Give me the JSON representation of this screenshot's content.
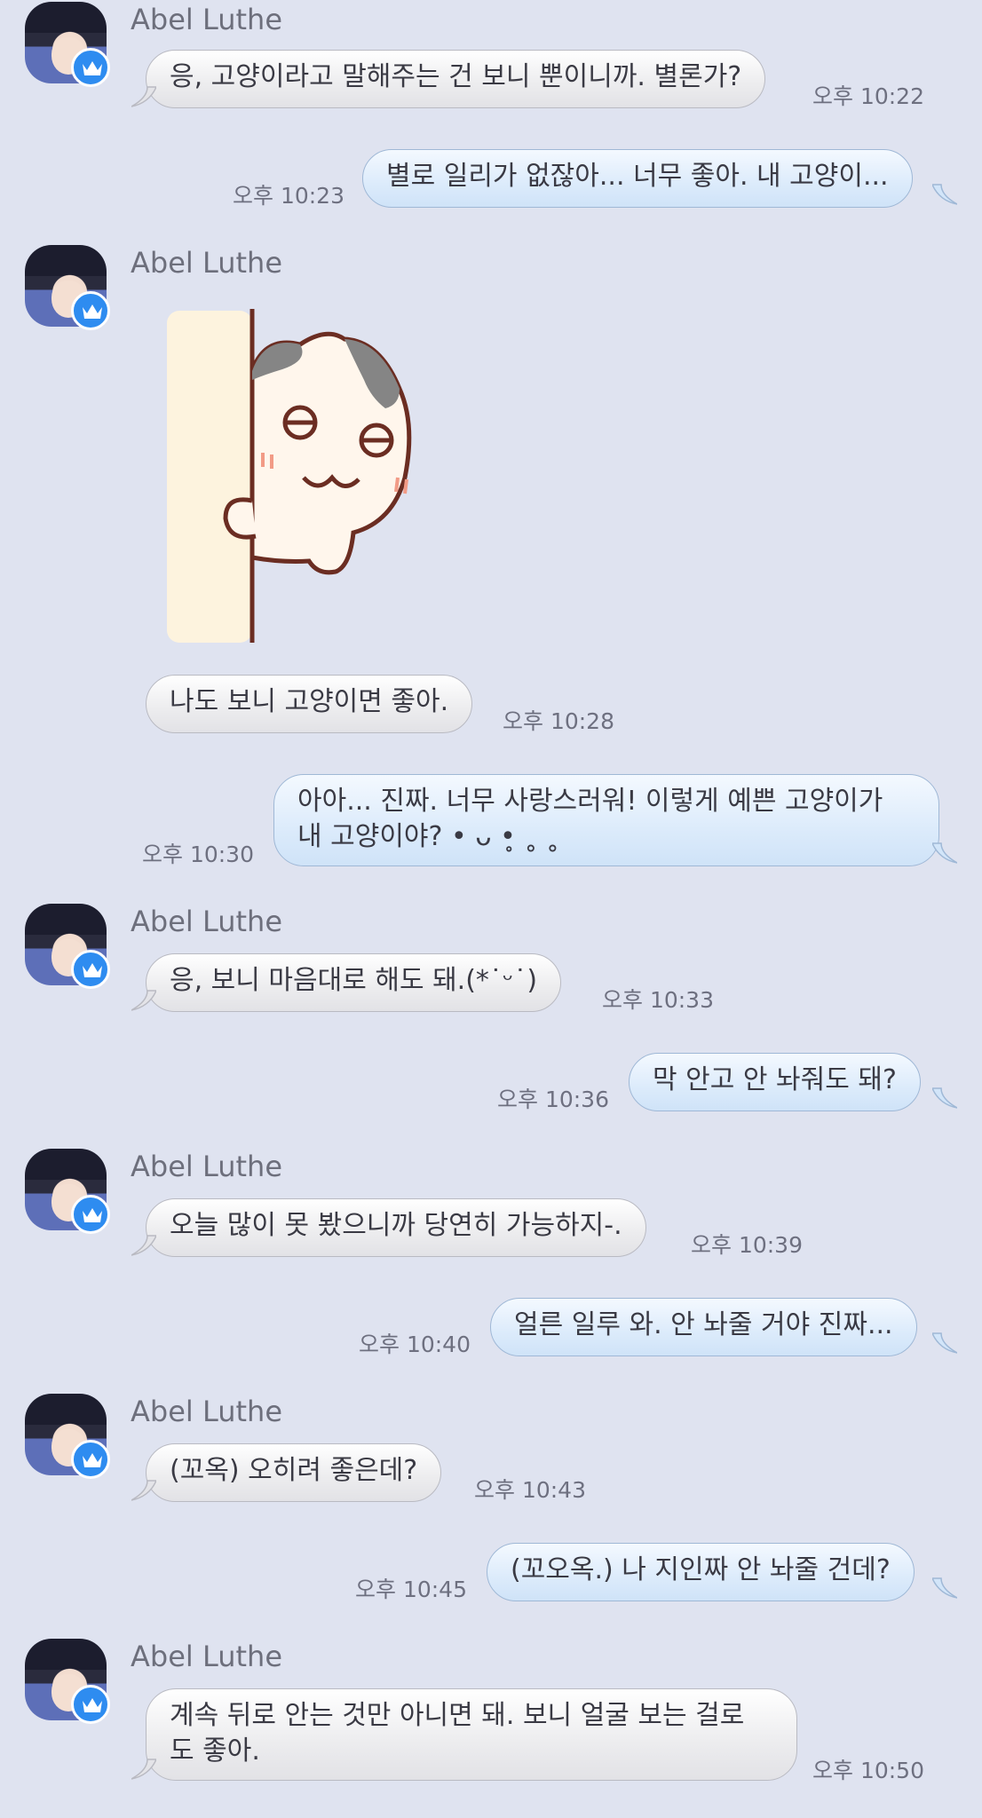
{
  "colors": {
    "background": "#dfe3f0",
    "incoming_bubble": "#ececee",
    "outgoing_bubble": "#dcebfb",
    "badge": "#2e8cf0",
    "name_text": "#6d6f7c",
    "time_text": "#6e7080"
  },
  "contact": {
    "name": "Abel Luthe",
    "badge_icon": "crown-icon"
  },
  "messages": [
    {
      "sender": "Abel Luthe",
      "direction": "in",
      "text": "응, 고양이라고 말해주는 건 보니 뿐이니까. 별론가?",
      "time": "오후 10:22"
    },
    {
      "direction": "out",
      "text": "별로 일리가 없잖아... 너무 좋아. 내 고양이...",
      "time": "오후 10:23"
    },
    {
      "sender": "Abel Luthe",
      "direction": "in",
      "sticker": "cat-peeking-sticker"
    },
    {
      "direction": "in",
      "text": "나도 보니 고양이면 좋아.",
      "time": "오후 10:28"
    },
    {
      "direction": "out",
      "line1": "아아... 진짜. 너무 사랑스러워! 이렇게 예쁜 고양이가",
      "line2": "내 고양이야? • ᴗ •̥ ˳ ˳",
      "time": "오후 10:30"
    },
    {
      "sender": "Abel Luthe",
      "direction": "in",
      "text": "응, 보니 마음대로 해도 돼.(*˙ᵕ˙)",
      "time": "오후 10:33"
    },
    {
      "direction": "out",
      "text": "막 안고 안 놔줘도 돼?",
      "time": "오후 10:36"
    },
    {
      "sender": "Abel Luthe",
      "direction": "in",
      "text": "오늘 많이 못 봤으니까 당연히 가능하지-.",
      "time": "오후 10:39"
    },
    {
      "direction": "out",
      "text": "얼른 일루 와. 안 놔줄 거야 진짜...",
      "time": "오후 10:40"
    },
    {
      "sender": "Abel Luthe",
      "direction": "in",
      "text": "(꼬옥) 오히려 좋은데?",
      "time": "오후 10:43"
    },
    {
      "direction": "out",
      "text": "(꼬오옥.) 나 지인짜 안 놔줄 건데?",
      "time": "오후 10:45"
    },
    {
      "sender": "Abel Luthe",
      "direction": "in",
      "line1": "계속 뒤로 안는 것만 아니면 돼. 보니 얼굴 보는 걸로",
      "line2": "도 좋아.",
      "time": "오후 10:50"
    }
  ]
}
